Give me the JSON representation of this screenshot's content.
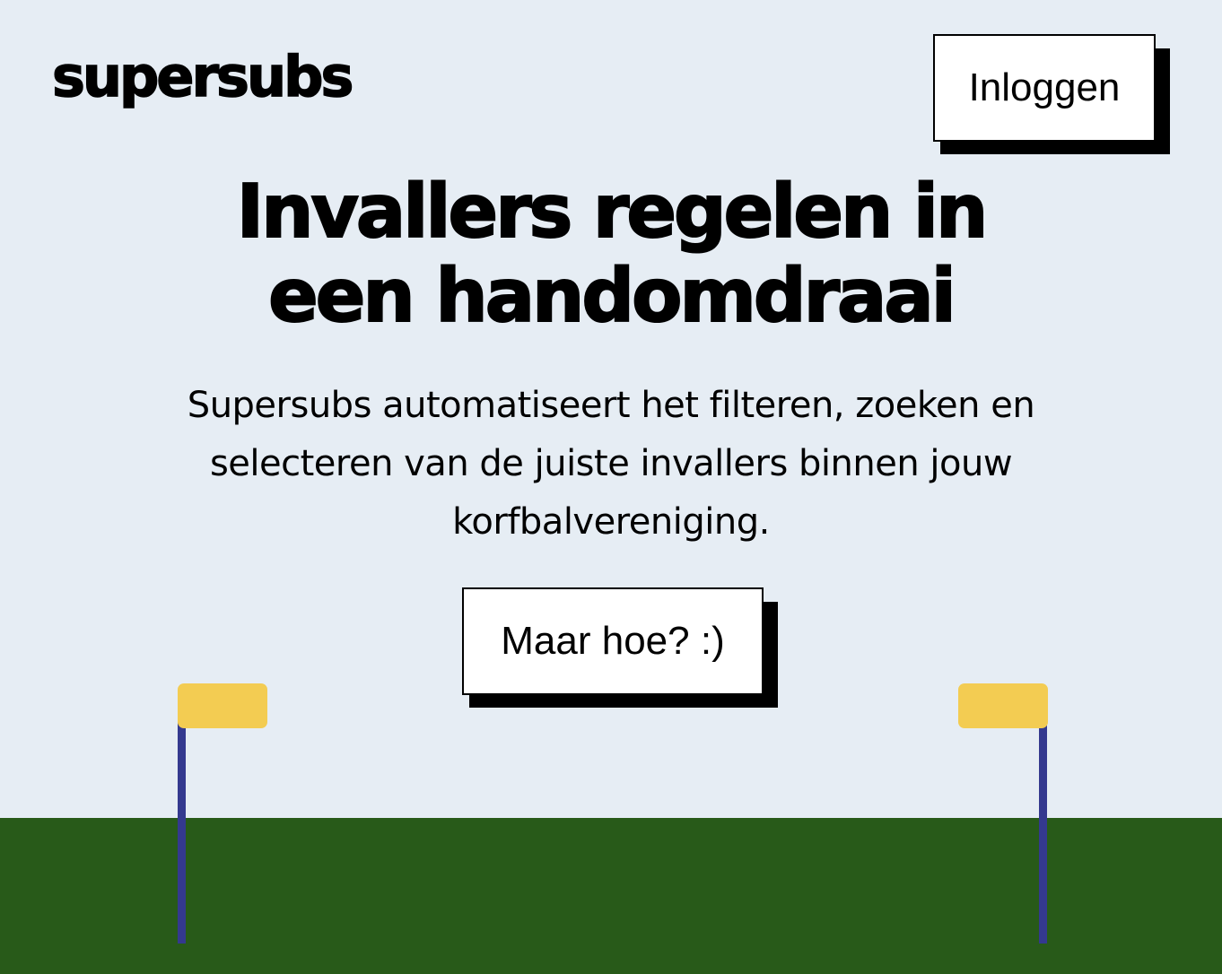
{
  "header": {
    "logo_text": "supersubs",
    "login_label": "Inloggen"
  },
  "hero": {
    "headline_line1": "Invallers regelen in",
    "headline_line2": "een handomdraai",
    "description": "Supersubs automatiseert het filteren, zoeken en selecteren van de juiste invallers binnen jouw korfbalvereniging.",
    "cta_label": "Maar hoe? :)"
  },
  "colors": {
    "background": "#e6edf4",
    "field": "#285a19",
    "pole": "#34398f",
    "basket": "#f3cc52",
    "button_bg": "#ffffff",
    "button_shadow": "#000000"
  },
  "illustration": {
    "left_pole": "korfbal-pole",
    "right_pole": "korfbal-pole"
  }
}
